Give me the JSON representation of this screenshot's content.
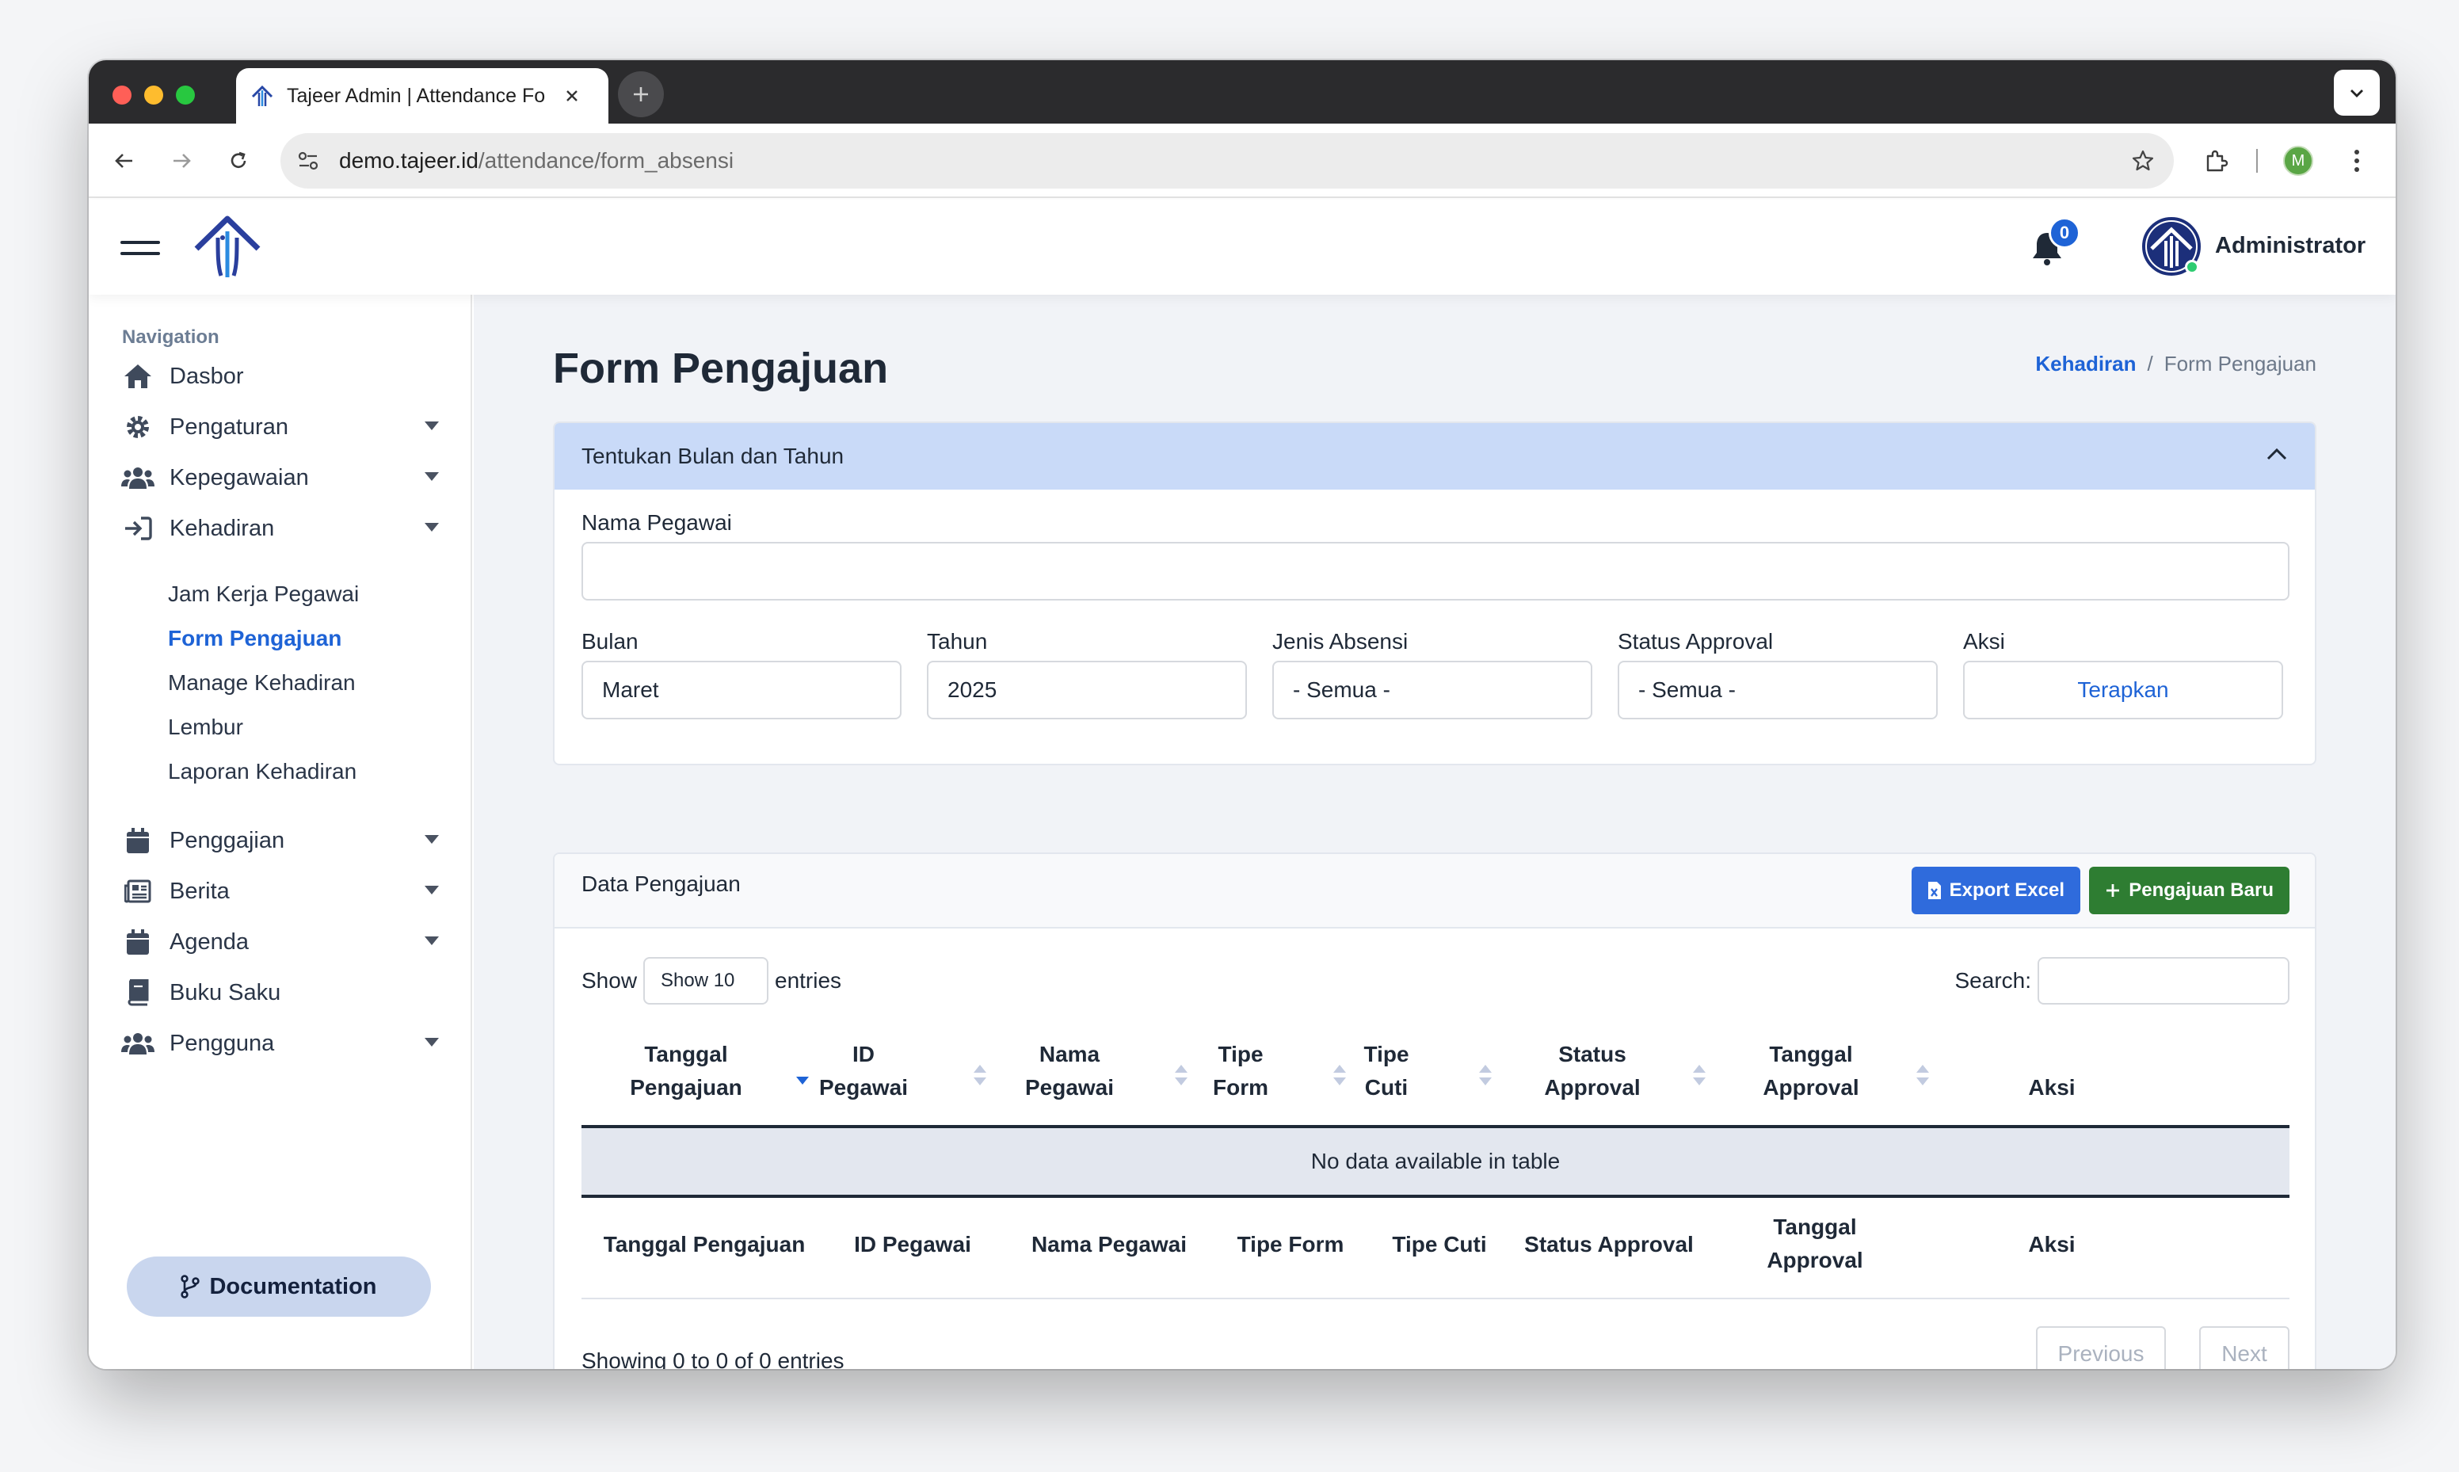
{
  "browser": {
    "tab_title": "Tajeer Admin | Attendance Fo",
    "url_host": "demo.tajeer.id",
    "url_path": "/attendance/form_absensi",
    "profile_initial": "M"
  },
  "header": {
    "notification_count": "0",
    "user_name": "Administrator"
  },
  "sidebar": {
    "nav_label": "Navigation",
    "items": [
      {
        "label": "Dasbor",
        "icon": "home-icon"
      },
      {
        "label": "Pengaturan",
        "icon": "gear-icon"
      },
      {
        "label": "Kepegawaian",
        "icon": "users-icon"
      },
      {
        "label": "Kehadiran",
        "icon": "sign-in-icon"
      },
      {
        "label": "Penggajian",
        "icon": "calendar-icon"
      },
      {
        "label": "Berita",
        "icon": "newspaper-icon"
      },
      {
        "label": "Agenda",
        "icon": "calendar-icon"
      },
      {
        "label": "Buku Saku",
        "icon": "book-icon"
      },
      {
        "label": "Pengguna",
        "icon": "users-icon"
      }
    ],
    "sub_items": [
      "Jam Kerja Pegawai",
      "Form Pengajuan",
      "Manage Kehadiran",
      "Lembur",
      "Laporan Kehadiran"
    ],
    "documentation_label": "Documentation"
  },
  "page": {
    "title": "Form Pengajuan",
    "breadcrumb_parent": "Kehadiran",
    "breadcrumb_sep": "/",
    "breadcrumb_current": "Form Pengajuan"
  },
  "filter": {
    "header": "Tentukan Bulan dan Tahun",
    "employee_label": "Nama Pegawai",
    "employee_value": "",
    "month_label": "Bulan",
    "month_value": "Maret",
    "year_label": "Tahun",
    "year_value": "2025",
    "type_label": "Jenis Absensi",
    "type_value": "- Semua -",
    "status_label": "Status Approval",
    "status_value": "- Semua -",
    "action_label": "Aksi",
    "apply_button": "Terapkan"
  },
  "data_card": {
    "header": "Data Pengajuan",
    "export_button": "Export Excel",
    "new_button": "Pengajuan Baru",
    "show_label": "Show",
    "show_value": "Show 10",
    "entries_label": "entries",
    "search_label": "Search:",
    "columns": [
      [
        "Tanggal",
        "Pengajuan"
      ],
      [
        "ID",
        "Pegawai"
      ],
      [
        "Nama",
        "Pegawai"
      ],
      [
        "Tipe",
        "Form"
      ],
      [
        "Tipe",
        "Cuti"
      ],
      [
        "Status",
        "Approval"
      ],
      [
        "Tanggal",
        "Approval"
      ],
      [
        "Aksi"
      ]
    ],
    "footer_columns": [
      "Tanggal Pengajuan",
      "ID Pegawai",
      "Nama Pegawai",
      "Tipe Form",
      "Tipe Cuti",
      "Status Approval",
      "Tanggal Approval",
      "Aksi"
    ],
    "empty_message": "No data available in table",
    "info": "Showing 0 to 0 of 0 entries",
    "prev_button": "Previous",
    "next_button": "Next"
  },
  "colors": {
    "accent": "#1e63d6",
    "export": "#2f6bdc",
    "new": "#2e7d32",
    "filter_header": "#c9daf8"
  }
}
